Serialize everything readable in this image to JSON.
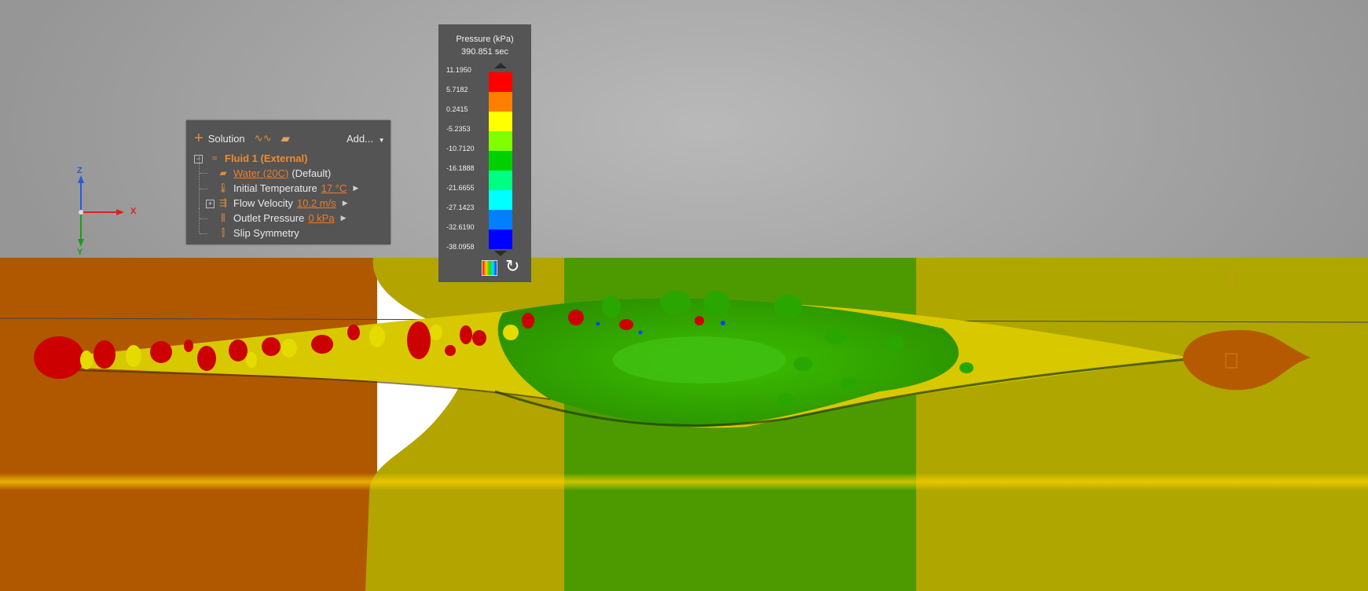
{
  "axes": {
    "z": "Z",
    "x": "X",
    "y": "Y"
  },
  "panel": {
    "solution_label": "Solution",
    "add_label": "Add...",
    "tree": {
      "fluid": "Fluid 1 (External)",
      "material": "Water (20C)",
      "material_suffix": "(Default)",
      "init_temp_label": "Initial Temperature",
      "init_temp_value": "17 °C",
      "flow_velocity_label": "Flow Velocity",
      "flow_velocity_value": "10.2 m/s",
      "outlet_pressure_label": "Outlet Pressure",
      "outlet_pressure_value": "0 kPa",
      "slip_symmetry_label": "Slip Symmetry"
    }
  },
  "legend": {
    "title": "Pressure (kPa)",
    "time": "390.851 sec",
    "values": [
      "11.1950",
      "5.7182",
      "0.2415",
      "-5.2353",
      "-10.7120",
      "-16.1888",
      "-21.6655",
      "-27.1423",
      "-32.6190",
      "-38.0958"
    ],
    "colors": [
      "#ff0000",
      "#ff8000",
      "#ffff00",
      "#80ff00",
      "#00d000",
      "#00ff80",
      "#00ffff",
      "#0080ff",
      "#0000ff"
    ]
  },
  "scene_colors": {
    "high": "#b35a00",
    "mid_high": "#b5aa00",
    "mid": "#4f9f00",
    "red": "#cc0000",
    "yellow": "#e0d800",
    "green": "#1fae00"
  }
}
